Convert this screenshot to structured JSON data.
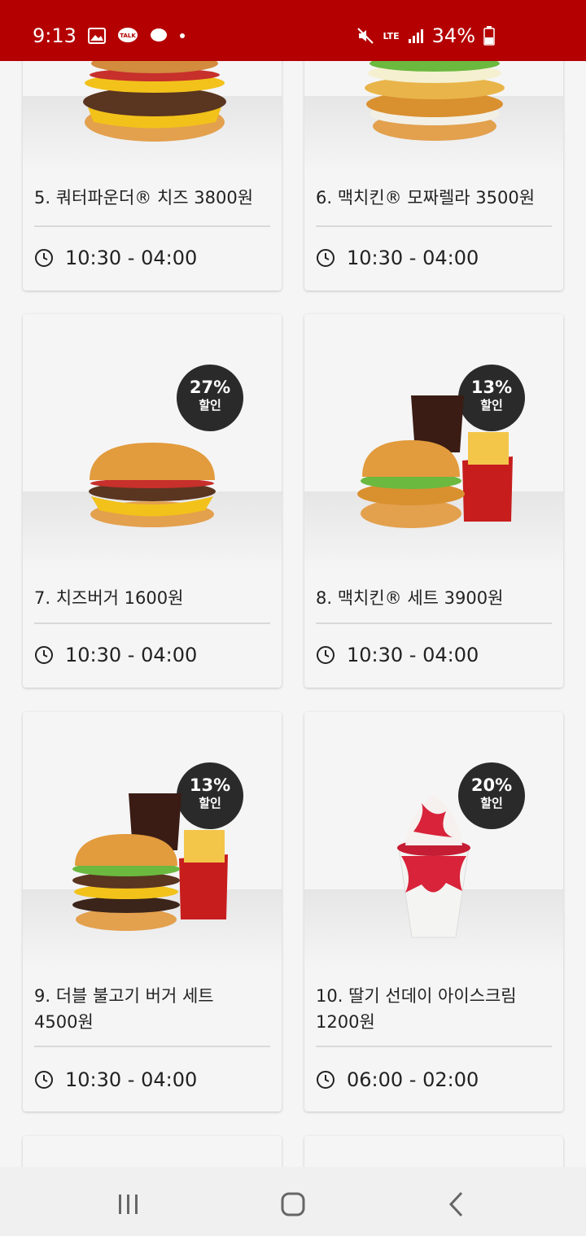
{
  "status_bar": {
    "time": "9:13",
    "network": "LTE",
    "battery": "34%"
  },
  "cards": [
    {
      "title": "5. 쿼터파운더® 치즈 3800원",
      "time": "10:30 - 04:00",
      "badge": null
    },
    {
      "title": "6. 맥치킨® 모짜렐라 3500원",
      "time": "10:30 - 04:00",
      "badge": null
    },
    {
      "title": "7. 치즈버거 1600원",
      "time": "10:30 - 04:00",
      "badge": {
        "percent": "27%",
        "label": "할인"
      }
    },
    {
      "title": "8. 맥치킨® 세트 3900원",
      "time": "10:30 - 04:00",
      "badge": {
        "percent": "13%",
        "label": "할인"
      }
    },
    {
      "title_line1": "9. 더블 불고기 버거 세트",
      "title_line2": "4500원",
      "time": "10:30 - 04:00",
      "badge": {
        "percent": "13%",
        "label": "할인"
      }
    },
    {
      "title_line1": "10. 딸기 선데이 아이스크림",
      "title_line2": "1200원",
      "time": "06:00 - 02:00",
      "badge": {
        "percent": "20%",
        "label": "할인"
      }
    }
  ],
  "nav": {
    "recent_icon": "recent-apps-icon",
    "home_icon": "home-icon",
    "back_icon": "back-icon"
  },
  "colors": {
    "status_bar": "#b40000",
    "badge": "#2a2a2a"
  }
}
